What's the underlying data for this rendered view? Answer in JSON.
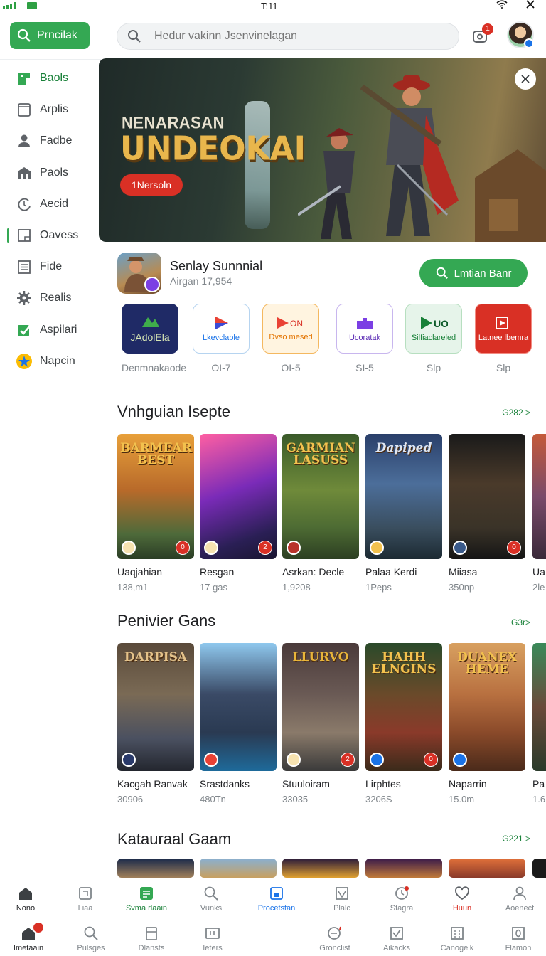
{
  "status_bar": {
    "time": "T:11"
  },
  "topbar": {
    "brand_button": "Prncilak",
    "search_placeholder": "Hedur vakinn Jsenvinelagan",
    "notification_count": "1"
  },
  "sidebar": {
    "items": [
      {
        "label": "Baols",
        "icon": "store-icon",
        "active": true
      },
      {
        "label": "Arplis",
        "icon": "tablet-icon"
      },
      {
        "label": "Fadbe",
        "icon": "person-icon"
      },
      {
        "label": "Paols",
        "icon": "building-icon"
      },
      {
        "label": "Aecid",
        "icon": "clock-icon"
      },
      {
        "label": "Oavess",
        "icon": "window-icon"
      },
      {
        "label": "Fide",
        "icon": "document-icon"
      },
      {
        "label": "Realis",
        "icon": "gear-icon"
      },
      {
        "label": "Aspilari",
        "icon": "checkbox-icon"
      },
      {
        "label": "Napcin",
        "icon": "star-badge-icon"
      }
    ]
  },
  "hero": {
    "subtitle": "NENARASAN",
    "title": "UNDEOKAI",
    "button": "1Nersoln"
  },
  "featured": {
    "name": "Senlay Sunnnial",
    "subtitle": "Airgan 17,954",
    "button": "Lmtian Banr"
  },
  "tiles": [
    {
      "text": "JAdolEla",
      "caption": "Denmnakaode",
      "accent": "#2e7d32"
    },
    {
      "text": "Lkevclable",
      "caption": "OI-7",
      "accent": "#1a73e8"
    },
    {
      "text": "Dvso mesed",
      "caption": "OI-5",
      "accent": "#e37400"
    },
    {
      "text": "Ucoratak",
      "caption": "SI-5",
      "accent": "#7b3fe4"
    },
    {
      "text": "Silfiaclareled",
      "caption": "Slp",
      "accent": "#188038"
    },
    {
      "text": "Latnee lbemra",
      "caption": "Slp",
      "accent": "#d93025"
    }
  ],
  "sections": [
    {
      "title": "Vnhguian Isepte",
      "more": "G282 >",
      "cards": [
        {
          "poster_title": "BARMEAR BEST",
          "name": "Uaqjahian",
          "meta": "138,m1",
          "badge": "0"
        },
        {
          "poster_title": "",
          "name": "Resgan",
          "meta": "17 gas",
          "badge": "2"
        },
        {
          "poster_title": "GARMIAN LASUSS",
          "name": "Asrkan: Decle",
          "meta": "1,9208",
          "badge": ""
        },
        {
          "poster_title": "Dapiped",
          "name": "Palaa Kerdi",
          "meta": "1Peps",
          "badge": ""
        },
        {
          "poster_title": "",
          "name": "Miiasa",
          "meta": "350np",
          "badge": "0"
        },
        {
          "poster_title": "",
          "name": "Ua",
          "meta": "2le",
          "badge": ""
        }
      ]
    },
    {
      "title": "Penivier Gans",
      "more": "G3r>",
      "cards": [
        {
          "poster_title": "DARPISA",
          "name": "Kacgah Ranvak",
          "meta": "30906",
          "badge": ""
        },
        {
          "poster_title": "",
          "name": "Srastdanks",
          "meta": "480Tn",
          "badge": ""
        },
        {
          "poster_title": "LLURVO",
          "name": "Stuuloiram",
          "meta": "33035",
          "badge": "2"
        },
        {
          "poster_title": "HAHH ELNGINS",
          "name": "Lirphtes",
          "meta": "3206S",
          "badge": "0"
        },
        {
          "poster_title": "DUANEX HEME",
          "name": "Naparrin",
          "meta": "15.0m",
          "badge": ""
        },
        {
          "poster_title": "",
          "name": "Pa",
          "meta": "1.6",
          "badge": ""
        }
      ]
    },
    {
      "title": "Katauraal Gaam",
      "more": "G221 >",
      "cards": []
    }
  ],
  "bottom_nav_primary": [
    {
      "label": "Nono",
      "icon": "home-icon",
      "active": true
    },
    {
      "label": "Liaa",
      "icon": "tablet-icon"
    },
    {
      "label": "Svma rlaain",
      "icon": "app-green-icon",
      "color": "#188038"
    },
    {
      "label": "Vunks",
      "icon": "search-icon"
    },
    {
      "label": "Procetstan",
      "icon": "bookmark-icon",
      "color": "#1a73e8"
    },
    {
      "label": "Plalc",
      "icon": "chart-icon"
    },
    {
      "label": "Stagra",
      "icon": "clock-icon"
    },
    {
      "label": "Huun",
      "icon": "heart-icon",
      "color": "#d93025"
    },
    {
      "label": "Aoenect",
      "icon": "person-icon"
    }
  ],
  "bottom_nav_secondary": [
    {
      "label": "Imetaain",
      "icon": "home-icon",
      "active": true
    },
    {
      "label": "Pulsges",
      "icon": "search-icon"
    },
    {
      "label": "Dlansts",
      "icon": "inbox-icon"
    },
    {
      "label": "Ieters",
      "icon": "ticket-icon"
    },
    {
      "label": "",
      "icon": ""
    },
    {
      "label": "Gronclist",
      "icon": "chat-icon"
    },
    {
      "label": "Aikacks",
      "icon": "checkbox-icon"
    },
    {
      "label": "Canogelk",
      "icon": "grid-icon"
    },
    {
      "label": "Flamon",
      "icon": "zero-box-icon"
    }
  ]
}
